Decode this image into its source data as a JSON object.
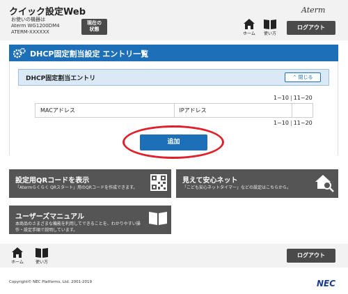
{
  "header": {
    "app_title": "クイック設定Web",
    "device_label": "お使いの機器は",
    "model": "Aterm WG1200DM4",
    "device_name": "ATERM-XXXXXX",
    "status_button": [
      "現在の",
      "状態"
    ],
    "brand": "Aterm",
    "home_label": "ホーム",
    "howto_label": "使い方",
    "logout_label": "ログアウト"
  },
  "section": {
    "title": "DHCP固定割当設定 エントリ一覧"
  },
  "entry_panel": {
    "title": "DHCP固定割当エントリ",
    "close_label": "閉じる",
    "pager": {
      "range": "1~10",
      "next": "11~20"
    },
    "columns": [
      "MACアドレス",
      "IPアドレス",
      ""
    ],
    "add_label": "追加"
  },
  "cards": [
    {
      "title": "設定用QRコードを表示",
      "desc": [
        "「Atermらくらく QRスタート」用のQRコードを作成できます。"
      ]
    },
    {
      "title": "見えて安心ネット",
      "desc": [
        "「こども安心ネットタイマー」などの設定はこちらから。"
      ]
    },
    {
      "title": "ユーザーズマニュアル",
      "desc": [
        "本商品のさまざまな機能を利用してできることを、わかりやすい操",
        "作・設定手順で説明しています。"
      ]
    }
  ],
  "footer": {
    "home_label": "ホーム",
    "howto_label": "使い方",
    "logout_label": "ログアウト",
    "copyright": "Copyright© NEC Platforms, Ltd. 2001-2019",
    "logo": "NEC"
  },
  "colors": {
    "accent": "#1d6fb8",
    "dark_button": "#4a4a4a",
    "card": "#555555",
    "highlight": "#e0202a"
  }
}
